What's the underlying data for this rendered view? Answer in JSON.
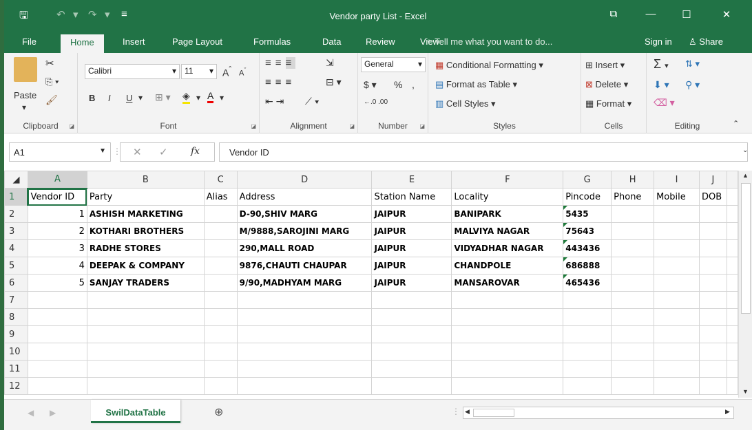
{
  "window": {
    "title": "Vendor  party List - Excel",
    "save_icon": "save-icon",
    "undo": "↶",
    "redo": "↷",
    "restore": "⧉",
    "minimize": "—",
    "maximize": "☐",
    "close": "✕"
  },
  "menu": {
    "tabs": [
      "File",
      "Home",
      "Insert",
      "Page Layout",
      "Formulas",
      "Data",
      "Review",
      "View"
    ],
    "tell_me": "Tell me what you want to do...",
    "sign_in": "Sign in",
    "share": "Share"
  },
  "ribbon": {
    "clipboard": {
      "label": "Clipboard",
      "paste": "Paste"
    },
    "font": {
      "label": "Font",
      "name": "Calibri",
      "size": "11",
      "bold": "B",
      "italic": "I",
      "underline": "U"
    },
    "alignment": {
      "label": "Alignment"
    },
    "number": {
      "label": "Number",
      "format": "General",
      "currency": "$",
      "percent": "%",
      "comma": ","
    },
    "styles": {
      "label": "Styles",
      "conditional": "Conditional Formatting",
      "format_table": "Format as Table",
      "cell_styles": "Cell Styles"
    },
    "cells": {
      "label": "Cells",
      "insert": "Insert",
      "delete": "Delete",
      "format": "Format"
    },
    "editing": {
      "label": "Editing"
    }
  },
  "formula_bar": {
    "name_box": "A1",
    "fx": "fx",
    "content": "Vendor ID"
  },
  "sheet": {
    "columns": [
      "A",
      "B",
      "C",
      "D",
      "E",
      "F",
      "G",
      "H",
      "I",
      "J"
    ],
    "header_row": [
      "Vendor ID",
      "Party",
      "Alias",
      "Address",
      "Station Name",
      "Locality",
      "Pincode",
      "Phone",
      "Mobile",
      "DOB"
    ],
    "rows": [
      [
        "1",
        "ASHISH MARKETING",
        "",
        "D-90,SHIV MARG",
        "JAIPUR",
        "BANIPARK",
        "5435"
      ],
      [
        "2",
        "KOTHARI BROTHERS",
        "",
        "M/9888,SAROJINI MARG",
        "JAIPUR",
        "MALVIYA NAGAR",
        "75643"
      ],
      [
        "3",
        "RADHE STORES",
        "",
        "290,MALL ROAD",
        "JAIPUR",
        "VIDYADHAR NAGAR",
        "443436"
      ],
      [
        "4",
        "DEEPAK & COMPANY",
        "",
        "9876,CHAUTI CHAUPAR",
        "JAIPUR",
        "CHANDPOLE",
        "686888"
      ],
      [
        "5",
        "SANJAY TRADERS",
        "",
        "9/90,MADHYAM MARG",
        "JAIPUR",
        "MANSAROVAR",
        "465436"
      ]
    ],
    "row_numbers": [
      "1",
      "2",
      "3",
      "4",
      "5",
      "6",
      "7",
      "8",
      "9",
      "10",
      "11",
      "12"
    ]
  },
  "sheet_tabs": {
    "active": "SwilDataTable",
    "add": "⊕"
  },
  "colors": {
    "accent": "#217346"
  }
}
